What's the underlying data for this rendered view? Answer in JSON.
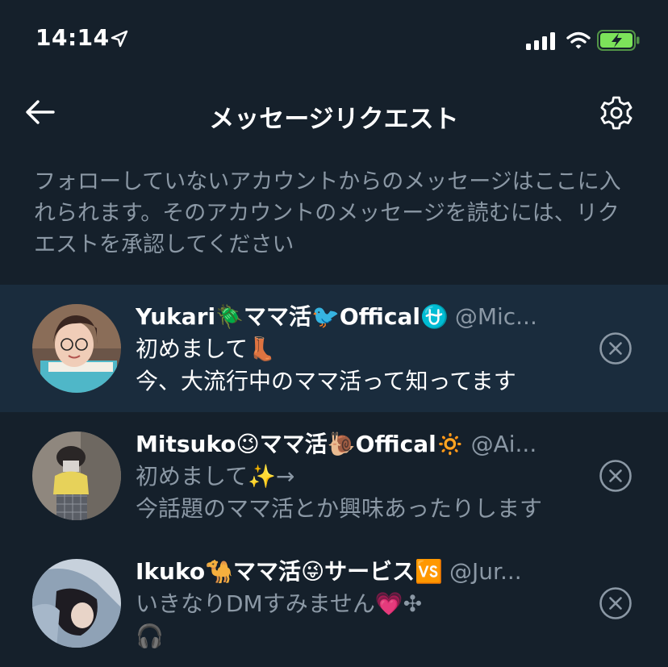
{
  "status_bar": {
    "time": "14:14"
  },
  "header": {
    "title": "メッセージリクエスト"
  },
  "description": "フォローしていないアカウントからのメッセージはここに入れられます。そのアカウントのメッセージを読むには、リクエストを承認してください",
  "requests": [
    {
      "name": "Yukari🪲ママ活🐦Offical⛎",
      "handle": "@Mic...",
      "line1": "初めまして👢",
      "line2": "今、大流行中のママ活って知ってます",
      "avatar_color": "#c9a98f"
    },
    {
      "name": "Mitsuko😉ママ活🐌Offical🔅",
      "handle": "@Ai...",
      "line1": "初めまして✨→",
      "line2": "今話題のママ活とか興味あったりします",
      "avatar_color": "#9a8f84"
    },
    {
      "name": "Ikuko🐪ママ活😜サービス🆚",
      "handle": "@Jur...",
      "line1": "いきなりDMすみません💗✣",
      "line2": "🎧",
      "avatar_color": "#b7c4d4"
    }
  ],
  "colors": {
    "background": "#15202b",
    "highlight": "#1a2c3d",
    "secondary_text": "#8b98a5",
    "battery": "#7ce35a"
  }
}
